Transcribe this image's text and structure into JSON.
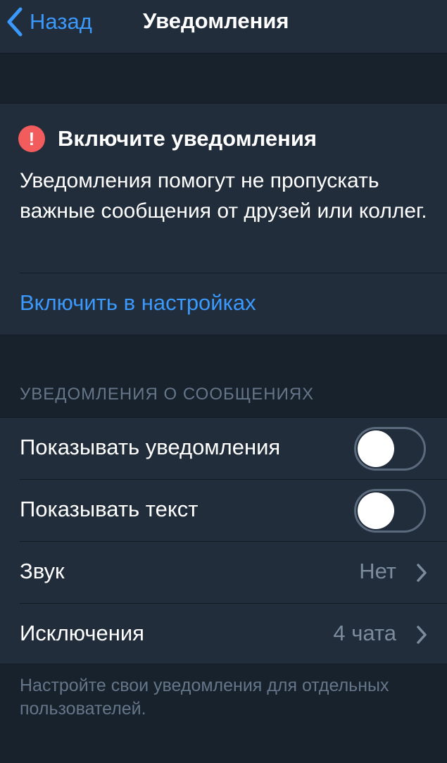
{
  "navbar": {
    "back_label": "Назад",
    "title": "Уведомления"
  },
  "alert": {
    "icon": "exclamation-circle-icon",
    "icon_glyph": "!",
    "icon_color": "#f25c5c",
    "title": "Включите уведомления",
    "body": "Уведомления помогут не пропускать важные сообщения от друзей или коллег.",
    "action_label": "Включить в настройках"
  },
  "message_notifications": {
    "header": "УВЕДОМЛЕНИЯ О СООБЩЕНИЯХ",
    "rows": [
      {
        "label": "Показывать уведомления",
        "type": "toggle",
        "on": false
      },
      {
        "label": "Показывать текст",
        "type": "toggle",
        "on": false
      },
      {
        "label": "Звук",
        "type": "disclosure",
        "value": "Нет"
      },
      {
        "label": "Исключения",
        "type": "disclosure",
        "value": "4 чата"
      }
    ],
    "footer": "Настройте свои уведомления для отдельных пользователей."
  },
  "colors": {
    "background": "#18222d",
    "cell": "#212d3b",
    "accent": "#3b99fc",
    "secondary_text": "#667689"
  }
}
